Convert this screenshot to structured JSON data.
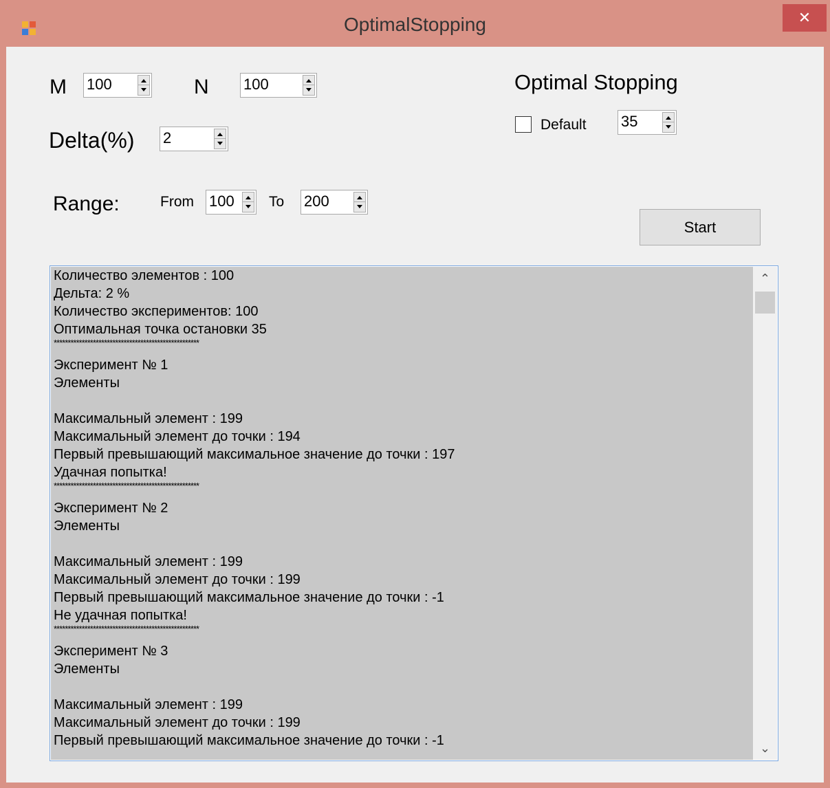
{
  "window": {
    "title": "OptimalStopping",
    "close_label": "✕"
  },
  "form": {
    "m_label": "M",
    "m_value": "100",
    "n_label": "N",
    "n_value": "100",
    "delta_label": "Delta(%)",
    "delta_value": "2",
    "range_label": "Range:",
    "from_label": "From",
    "from_value": "100",
    "to_label": "To",
    "to_value": "200",
    "optimal_title": "Optimal Stopping",
    "default_label": "Default",
    "default_checked": false,
    "optimal_value": "35",
    "start_label": "Start"
  },
  "log": {
    "lines": [
      "Количество элементов : 100",
      "Дельта: 2 %",
      "Количество экспериментов: 100",
      "Оптимальная точка остановки 35",
      "****************************************************",
      "Эксперимент № 1",
      "Элементы",
      "",
      "Максимальный элемент : 199",
      "Максимальный элемент до точки : 194",
      "Первый превышающий максимальное значение до точки : 197",
      "Удачная попытка!",
      "****************************************************",
      "Эксперимент № 2",
      "Элементы",
      "",
      "Максимальный элемент : 199",
      "Максимальный элемент до точки : 199",
      "Первый превышающий максимальное значение до точки : -1",
      "Не удачная попытка!",
      "****************************************************",
      "Эксперимент № 3",
      "Элементы",
      "",
      "Максимальный элемент : 199",
      "Максимальный элемент до точки : 199",
      "Первый превышающий максимальное значение до точки : -1"
    ]
  },
  "colors": {
    "titlebar": "#d99286",
    "close": "#c75050",
    "log_bg": "#c8c8c8"
  }
}
